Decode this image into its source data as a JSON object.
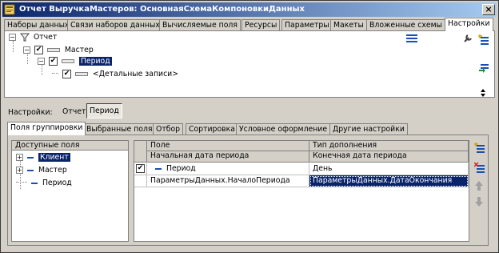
{
  "window": {
    "title": "Отчет ВыручкаМастеров: ОсновнаяСхемаКомпоновкиДанных",
    "close_label": "×"
  },
  "top_tabs": [
    {
      "label": "Наборы данных",
      "active": false
    },
    {
      "label": "Связи наборов данных",
      "active": false
    },
    {
      "label": "Вычисляемые поля",
      "active": false
    },
    {
      "label": "Ресурсы",
      "active": false
    },
    {
      "label": "Параметры",
      "active": false
    },
    {
      "label": "Макеты",
      "active": false
    },
    {
      "label": "Вложенные схемы",
      "active": false
    },
    {
      "label": "Настройки",
      "active": true
    }
  ],
  "structure": {
    "root": {
      "label": "Отчет",
      "toggle": "−"
    },
    "master": {
      "label": "Мастер",
      "toggle": "−"
    },
    "period": {
      "label": "Период",
      "toggle": "−"
    },
    "details": {
      "label": "<Детальные записи>"
    }
  },
  "settings": {
    "label": "Настройки:",
    "report": "Отчет",
    "period": "Период"
  },
  "lower_tabs": [
    {
      "label": "Поля группировки",
      "active": true
    },
    {
      "label": "Выбранные поля",
      "active": false
    },
    {
      "label": "Отбор",
      "active": false
    },
    {
      "label": "Сортировка",
      "active": false
    },
    {
      "label": "Условное оформление",
      "active": false
    },
    {
      "label": "Другие настройки",
      "active": false
    }
  ],
  "available_fields": {
    "header": "Доступные поля",
    "items": [
      {
        "label": "Клиент",
        "expand": "+",
        "selected": true
      },
      {
        "label": "Мастер",
        "expand": "+",
        "selected": false
      },
      {
        "label": "Период",
        "expand": "",
        "selected": false
      }
    ]
  },
  "grouping_grid": {
    "headers": {
      "field": "Поле",
      "subfield": "Начальная дата периода",
      "type": "Тип дополнения",
      "subtype": "Конечная дата периода"
    },
    "rows": [
      {
        "check": "✔",
        "field": "Период",
        "type": "День"
      },
      {
        "field": "ПараметрыДанных.НачалоПериода",
        "type": "ПараметрыДанных.ДатаОкончания"
      }
    ]
  },
  "icons": {
    "check": "✔",
    "dash": "−"
  }
}
